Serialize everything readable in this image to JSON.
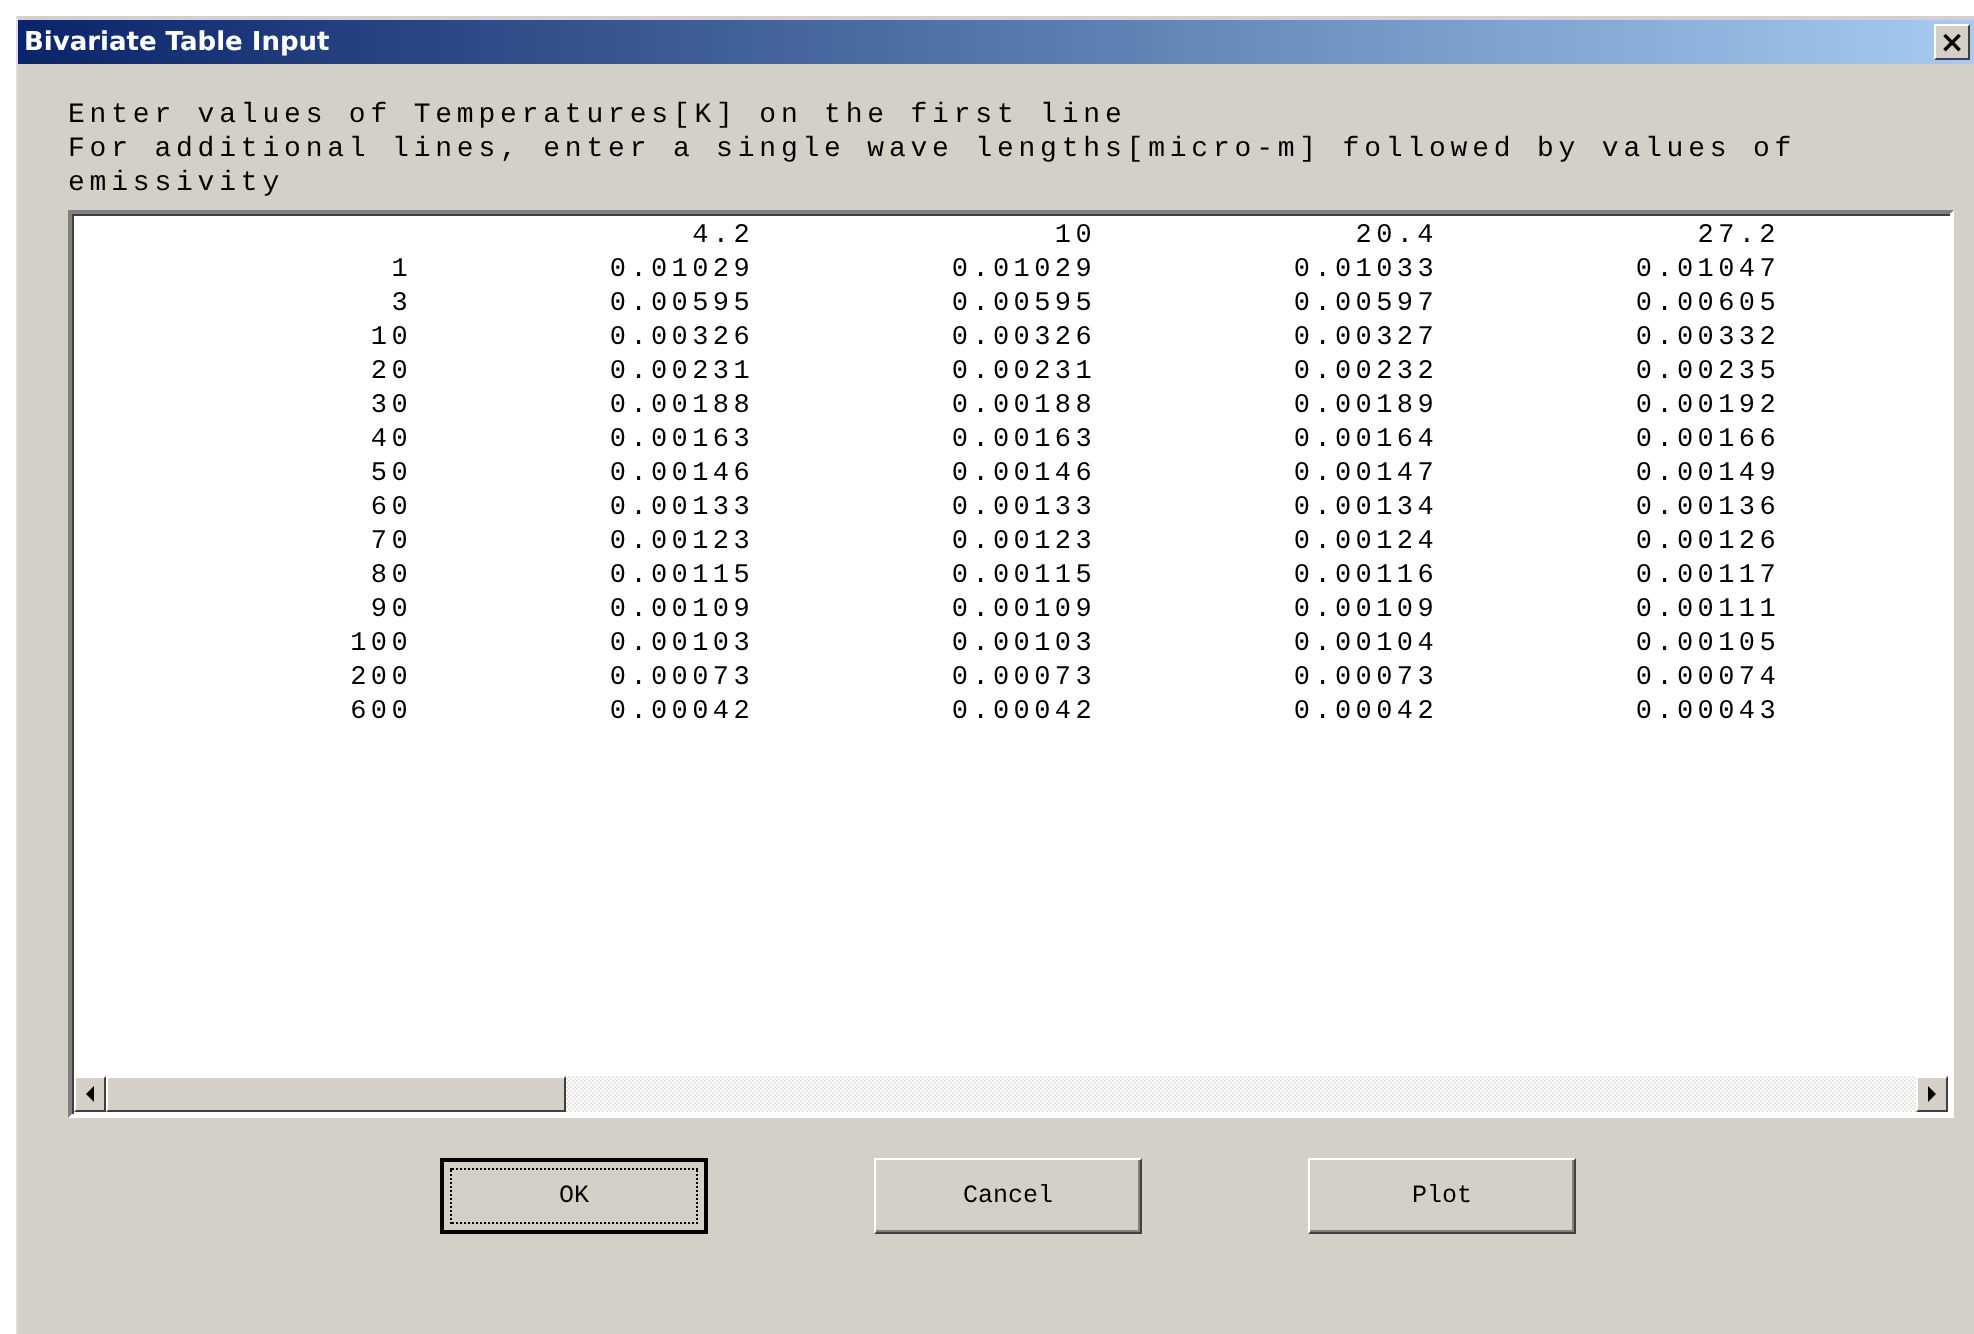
{
  "window": {
    "title": "Bivariate Table Input",
    "close_glyph": "×"
  },
  "instructions": [
    "Enter values of Temperatures[K] on the first line",
    "For additional lines, enter a single wave lengths[micro-m] followed by values of",
    "emissivity"
  ],
  "table": {
    "header": [
      "4.2",
      "10",
      "20.4",
      "27.2"
    ],
    "rows": [
      [
        "1",
        "0.01029",
        "0.01029",
        "0.01033",
        "0.01047"
      ],
      [
        "3",
        "0.00595",
        "0.00595",
        "0.00597",
        "0.00605"
      ],
      [
        "10",
        "0.00326",
        "0.00326",
        "0.00327",
        "0.00332"
      ],
      [
        "20",
        "0.00231",
        "0.00231",
        "0.00232",
        "0.00235"
      ],
      [
        "30",
        "0.00188",
        "0.00188",
        "0.00189",
        "0.00192"
      ],
      [
        "40",
        "0.00163",
        "0.00163",
        "0.00164",
        "0.00166"
      ],
      [
        "50",
        "0.00146",
        "0.00146",
        "0.00147",
        "0.00149"
      ],
      [
        "60",
        "0.00133",
        "0.00133",
        "0.00134",
        "0.00136"
      ],
      [
        "70",
        "0.00123",
        "0.00123",
        "0.00124",
        "0.00126"
      ],
      [
        "80",
        "0.00115",
        "0.00115",
        "0.00116",
        "0.00117"
      ],
      [
        "90",
        "0.00109",
        "0.00109",
        "0.00109",
        "0.00111"
      ],
      [
        "100",
        "0.00103",
        "0.00103",
        "0.00104",
        "0.00105"
      ],
      [
        "200",
        "0.00073",
        "0.00073",
        "0.00073",
        "0.00074"
      ],
      [
        "600",
        "0.00042",
        "0.00042",
        "0.00042",
        "0.00043"
      ]
    ]
  },
  "buttons": [
    {
      "label": "OK",
      "focused": true
    },
    {
      "label": "Cancel",
      "focused": false
    },
    {
      "label": "Plot",
      "focused": false
    }
  ]
}
